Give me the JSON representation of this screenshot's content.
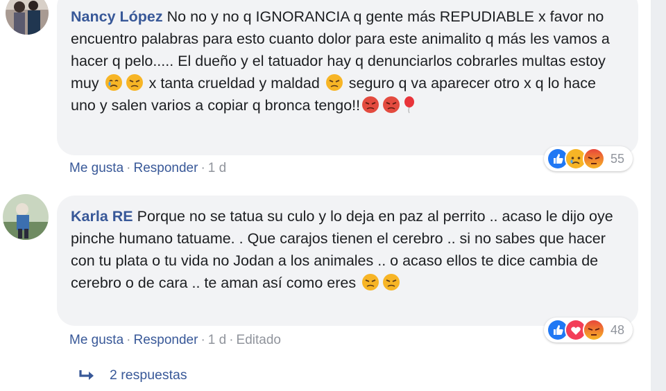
{
  "comments": [
    {
      "author": "Nancy López",
      "text_parts": [
        "No no y no q IGNORANCIA q gente más REPUDIABLE x favor no encuentro palabras para esto cuanto dolor para este animalito q más les vamos a hacer q pelo..... El dueño y el tatuador hay q denunciarlos cobrarles multas estoy muy",
        "x tanta crueldad y maldad",
        "seguro q va aparecer otro x q lo hace uno y salen varios a copiar q bronca tengo!!"
      ],
      "reaction_count": "55",
      "actions": {
        "like": "Me gusta",
        "reply": "Responder",
        "time": "1 d"
      }
    },
    {
      "author": "Karla RE",
      "text_parts": [
        "Porque no se tatua su culo y lo deja en paz al perrito .. acaso le dijo oye pinche humano tatuame. . Que carajos tienen el cerebro .. si no sabes que hacer con tu plata o tu vida no Jodan a los animales .. o acaso ellos te dice cambia de cerebro o de cara .. te aman así como eres"
      ],
      "reaction_count": "48",
      "actions": {
        "like": "Me gusta",
        "reply": "Responder",
        "time": "1 d",
        "edited": "Editado"
      }
    }
  ],
  "replies_label": "2 respuestas",
  "colors": {
    "link": "#385898",
    "meta": "#90949c",
    "bubble": "#f2f3f5",
    "like": "#2078f4",
    "love": "#f33e58",
    "angry": "#e9710f"
  }
}
